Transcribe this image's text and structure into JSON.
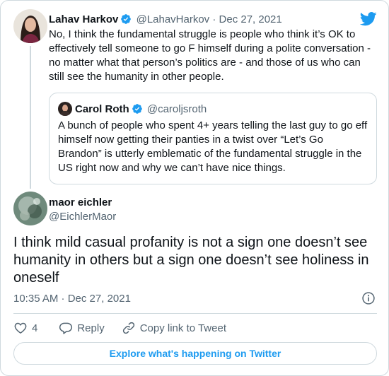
{
  "parent_tweet": {
    "author_name": "Lahav Harkov",
    "author_handle": "@LahavHarkov",
    "separator": "·",
    "date": "Dec 27, 2021",
    "text": "No, I think the fundamental struggle is people who think it’s OK to effectively tell someone to go F himself during a polite conversation - no matter what that person’s politics are - and those of us who can still see the humanity in other people."
  },
  "quoted_tweet": {
    "author_name": "Carol Roth",
    "author_handle": "@caroljsroth",
    "text": "A bunch of people who spent 4+ years telling the last guy to go eff himself now getting their panties in a twist over “Let’s Go Brandon” is utterly emblematic of the fundamental struggle in the US right now and why we can’t have nice things."
  },
  "main_tweet": {
    "author_name": "maor eichler",
    "author_handle": "@EichlerMaor",
    "text": "I think mild casual profanity is not a sign one doesn’t see humanity in others but a sign one doesn’t see holiness in oneself",
    "timestamp": "10:35 AM · Dec 27, 2021"
  },
  "actions": {
    "like_count": "4",
    "reply_label": "Reply",
    "copy_link_label": "Copy link to Tweet"
  },
  "explore_label": "Explore what's happening on Twitter",
  "colors": {
    "accent": "#1d9bf0",
    "text": "#0f1419",
    "secondary": "#536471",
    "border": "#cfd9de"
  },
  "icons": [
    "twitter-bird-icon",
    "verified-badge-icon",
    "info-icon",
    "heart-icon",
    "reply-icon",
    "link-icon"
  ]
}
